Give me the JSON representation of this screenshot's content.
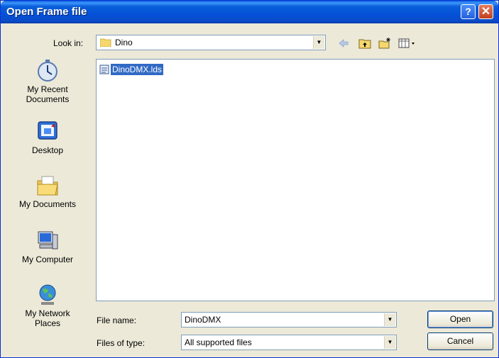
{
  "window": {
    "title": "Open Frame file"
  },
  "lookin": {
    "label": "Look in:",
    "value": "Dino"
  },
  "places": [
    {
      "label": "My Recent\nDocuments",
      "icon": "recent-documents-icon"
    },
    {
      "label": "Desktop",
      "icon": "desktop-icon"
    },
    {
      "label": "My Documents",
      "icon": "my-documents-icon"
    },
    {
      "label": "My Computer",
      "icon": "my-computer-icon"
    },
    {
      "label": "My Network\nPlaces",
      "icon": "network-places-icon"
    }
  ],
  "files": [
    {
      "name": "DinoDMX.lds",
      "selected": true
    }
  ],
  "filename": {
    "label": "File name:",
    "value": "DinoDMX"
  },
  "filetype": {
    "label": "Files of type:",
    "value": "All supported files"
  },
  "buttons": {
    "open": "Open",
    "cancel": "Cancel"
  },
  "colors": {
    "titlebar": "#0a5fd8",
    "selection": "#316ac5",
    "dialog_bg": "#ece9d8"
  }
}
